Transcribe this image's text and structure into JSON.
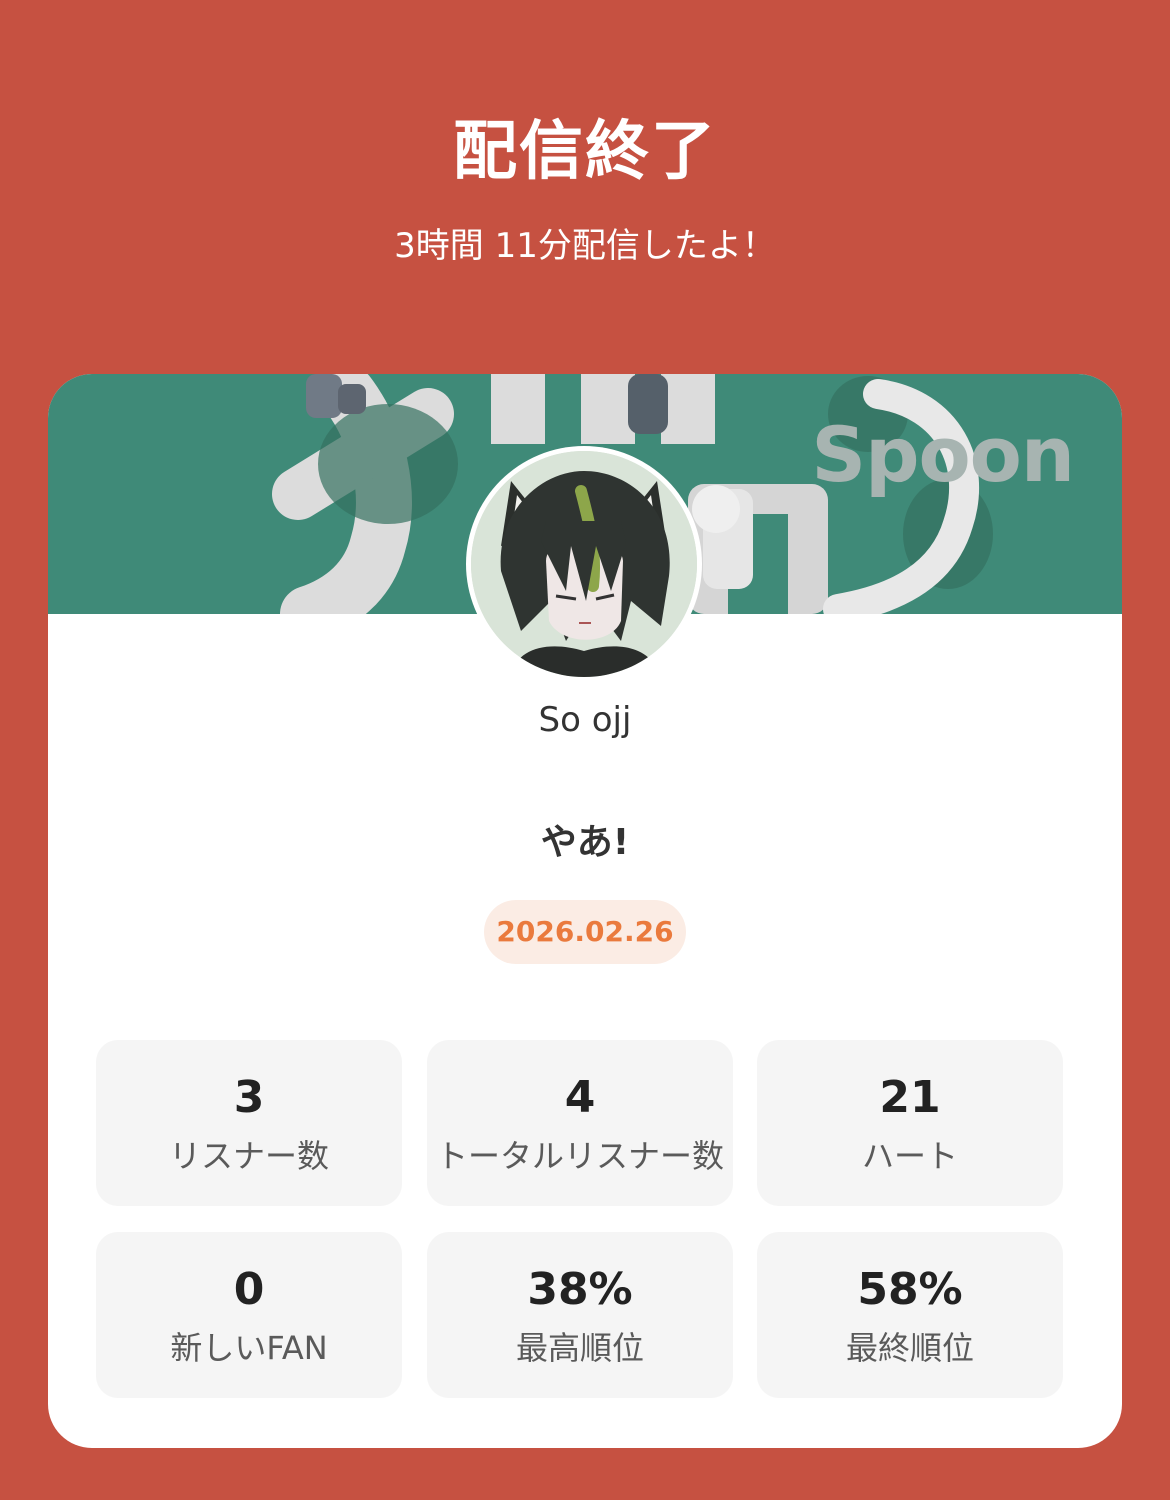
{
  "header": {
    "title": "配信終了",
    "subtitle": "3時間 11分配信したよ！"
  },
  "banner": {
    "brand_text": "Spoon",
    "background_color": "#3f8a78"
  },
  "profile": {
    "avatar_icon": "user-avatar",
    "username": "So ojj"
  },
  "room": {
    "title": "やあ!",
    "date": "2026.02.26"
  },
  "stats": [
    {
      "value": "3",
      "label": "リスナー数"
    },
    {
      "value": "4",
      "label": "トータルリスナー数"
    },
    {
      "value": "21",
      "label": "ハート"
    },
    {
      "value": "0",
      "label": "新しいFAN"
    },
    {
      "value": "38%",
      "label": "最高順位"
    },
    {
      "value": "58%",
      "label": "最終順位"
    }
  ],
  "colors": {
    "page_background": "#c65141",
    "accent_date": "#ea7a3d",
    "date_pill_bg": "#fbece4",
    "stat_tile_bg": "#f5f5f5"
  }
}
